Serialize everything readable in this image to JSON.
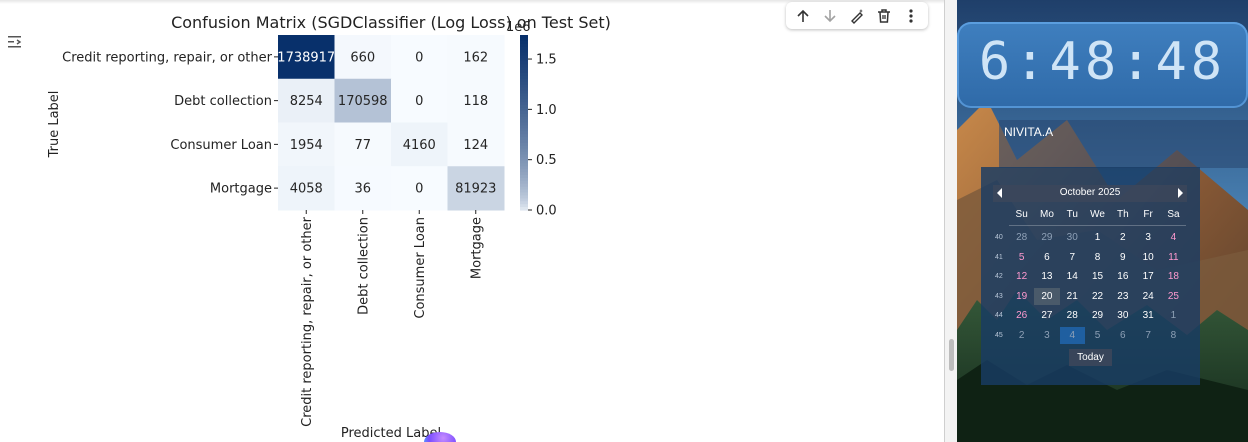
{
  "chart_data": {
    "type": "heatmap",
    "title": "Confusion Matrix (SGDClassifier (Log Loss) on Test Set)",
    "xlabel": "Predicted Label",
    "ylabel": "True Label",
    "row_labels": [
      "Credit reporting, repair, or other",
      "Debt collection",
      "Consumer Loan",
      "Mortgage"
    ],
    "col_labels": [
      "Credit reporting, repair, or other",
      "Debt collection",
      "Consumer Loan",
      "Mortgage"
    ],
    "matrix": [
      [
        1738917,
        660,
        0,
        162
      ],
      [
        8254,
        170598,
        0,
        118
      ],
      [
        1954,
        77,
        4160,
        124
      ],
      [
        4058,
        36,
        0,
        81923
      ]
    ],
    "cell_labels": [
      [
        "1738917",
        "660",
        "0",
        "162"
      ],
      [
        "8254",
        "170598",
        "0",
        "118"
      ],
      [
        "1954",
        "77",
        "4160",
        "124"
      ],
      [
        "4058",
        "36",
        "0",
        "81923"
      ]
    ],
    "colorbar": {
      "min": 0,
      "max": 1738917,
      "ticks": [
        0.0,
        0.5,
        1.0,
        1.5
      ],
      "tick_labels": [
        "0.0",
        "0.5",
        "1.0",
        "1.5"
      ],
      "exponent_label": "1e6",
      "colormap": "Blues"
    },
    "colors": {
      "low": "#f7fbff",
      "high": "#08306b"
    }
  },
  "toolbar": {
    "icons": [
      "arrow-up-icon",
      "arrow-down-icon",
      "edit-magic-icon",
      "trash-icon",
      "more-vertical-icon"
    ]
  },
  "clock": {
    "time": "6:48:48"
  },
  "user": {
    "name": "NIVITA.A"
  },
  "calendar": {
    "month_label": "October 2025",
    "day_headers": [
      "Su",
      "Mo",
      "Tu",
      "We",
      "Th",
      "Fr",
      "Sa"
    ],
    "weeks": [
      {
        "week": "40",
        "days": [
          "28",
          "29",
          "30",
          "1",
          "2",
          "3",
          "4"
        ]
      },
      {
        "week": "41",
        "days": [
          "5",
          "6",
          "7",
          "8",
          "9",
          "10",
          "11"
        ]
      },
      {
        "week": "42",
        "days": [
          "12",
          "13",
          "14",
          "15",
          "16",
          "17",
          "18"
        ]
      },
      {
        "week": "43",
        "days": [
          "19",
          "20",
          "21",
          "22",
          "23",
          "24",
          "25"
        ]
      },
      {
        "week": "44",
        "days": [
          "26",
          "27",
          "28",
          "29",
          "30",
          "31",
          "1"
        ]
      },
      {
        "week": "45",
        "days": [
          "2",
          "3",
          "4",
          "5",
          "6",
          "7",
          "8"
        ]
      }
    ],
    "selected_day": "20",
    "today_day": "4",
    "today_label": "Today"
  }
}
